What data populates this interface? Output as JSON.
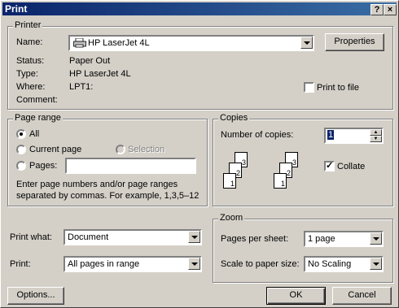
{
  "window": {
    "title": "Print",
    "help_btn": "?",
    "close_btn": "×"
  },
  "printer": {
    "legend": "Printer",
    "name_label": "Name:",
    "name_value": "HP LaserJet 4L",
    "properties_button": "Properties",
    "status_label": "Status:",
    "status_value": "Paper Out",
    "type_label": "Type:",
    "type_value": "HP LaserJet 4L",
    "where_label": "Where:",
    "where_value": "LPT1:",
    "comment_label": "Comment:",
    "print_to_file_label": "Print to file",
    "print_to_file_checked": false
  },
  "page_range": {
    "legend": "Page range",
    "all_label": "All",
    "current_label": "Current page",
    "selection_label": "Selection",
    "pages_label": "Pages:",
    "pages_value": "",
    "selected": "all",
    "help_text_line1": "Enter page numbers and/or page ranges",
    "help_text_line2": "separated by commas.  For example, 1,3,5–12"
  },
  "copies": {
    "legend": "Copies",
    "number_label": "Number of copies:",
    "number_value": "1",
    "collate_label": "Collate",
    "collate_checked": true,
    "page_digits": [
      "1",
      "2",
      "3"
    ]
  },
  "print_what": {
    "label": "Print what:",
    "value": "Document"
  },
  "print_range": {
    "label": "Print:",
    "value": "All pages in range"
  },
  "zoom": {
    "legend": "Zoom",
    "pages_per_sheet_label": "Pages per sheet:",
    "pages_per_sheet_value": "1 page",
    "scale_label": "Scale to paper size:",
    "scale_value": "No Scaling"
  },
  "buttons": {
    "options": "Options...",
    "ok": "OK",
    "cancel": "Cancel"
  }
}
